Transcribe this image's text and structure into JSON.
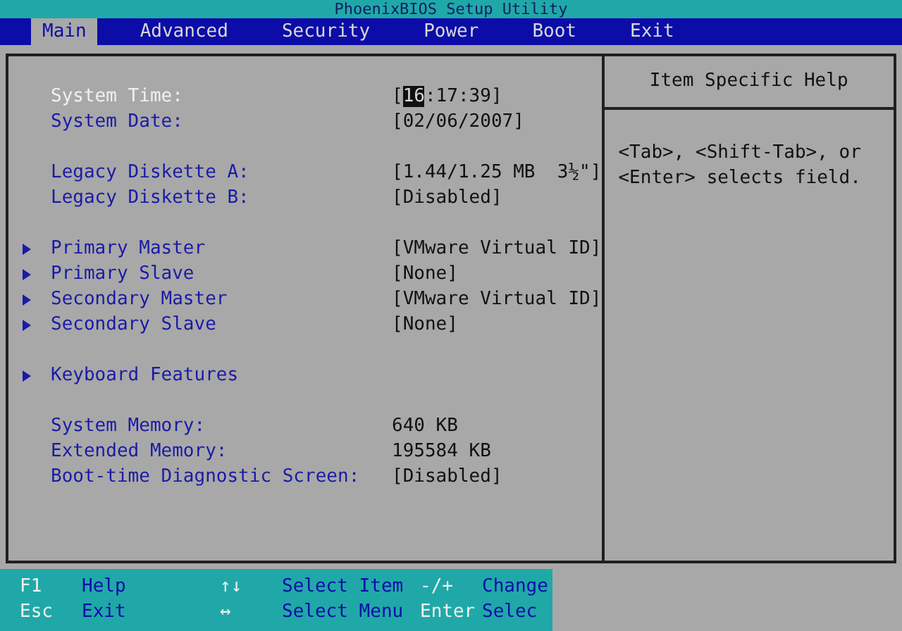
{
  "window": {
    "title": "PhoenixBIOS Setup Utility"
  },
  "tabs": [
    {
      "label": "Main",
      "selected": true
    },
    {
      "label": "Advanced",
      "selected": false
    },
    {
      "label": "Security",
      "selected": false
    },
    {
      "label": "Power",
      "selected": false
    },
    {
      "label": "Boot",
      "selected": false
    },
    {
      "label": "Exit",
      "selected": false
    }
  ],
  "groups": [
    {
      "items": [
        {
          "kind": "field",
          "label": "System Time:",
          "selected": true,
          "value": [
            {
              "text": "[",
              "selected": false
            },
            {
              "text": "16",
              "selected": true
            },
            {
              "text": ":17:39]",
              "selected": false
            }
          ]
        },
        {
          "kind": "field",
          "label": "System Date:",
          "selected": false,
          "value": "[02/06/2007]"
        }
      ]
    },
    {
      "items": [
        {
          "kind": "field",
          "label": "Legacy Diskette A:",
          "selected": false,
          "value": "[1.44/1.25 MB  3½\"]"
        },
        {
          "kind": "field",
          "label": "Legacy Diskette B:",
          "selected": false,
          "value": "[Disabled]"
        }
      ]
    },
    {
      "items": [
        {
          "kind": "submenu",
          "label": "Primary Master",
          "selected": false,
          "value": "[VMware Virtual ID]"
        },
        {
          "kind": "submenu",
          "label": "Primary Slave",
          "selected": false,
          "value": "[None]"
        },
        {
          "kind": "submenu",
          "label": "Secondary Master",
          "selected": false,
          "value": "[VMware Virtual ID]"
        },
        {
          "kind": "submenu",
          "label": "Secondary Slave",
          "selected": false,
          "value": "[None]"
        }
      ]
    },
    {
      "items": [
        {
          "kind": "submenu",
          "label": "Keyboard Features",
          "selected": false
        }
      ]
    },
    {
      "items": [
        {
          "kind": "info",
          "label": "System Memory:",
          "selected": false,
          "value": "640 KB"
        },
        {
          "kind": "info",
          "label": "Extended Memory:",
          "selected": false,
          "value": "195584 KB"
        },
        {
          "kind": "field",
          "label": "Boot-time Diagnostic Screen:",
          "selected": false,
          "value": "[Disabled]"
        }
      ]
    }
  ],
  "help": {
    "title": "Item Specific Help",
    "text": "<Tab>, <Shift-Tab>, or <Enter> selects field."
  },
  "footer": [
    [
      {
        "key": "F1",
        "action": "Help"
      },
      {
        "key": "↑↓",
        "action": "Select Item"
      },
      {
        "key": "-/+",
        "action": "Change"
      }
    ],
    [
      {
        "key": "Esc",
        "action": "Exit"
      },
      {
        "key": "↔",
        "action": "Select Menu"
      },
      {
        "key": "Enter",
        "action": "Selec"
      }
    ]
  ]
}
